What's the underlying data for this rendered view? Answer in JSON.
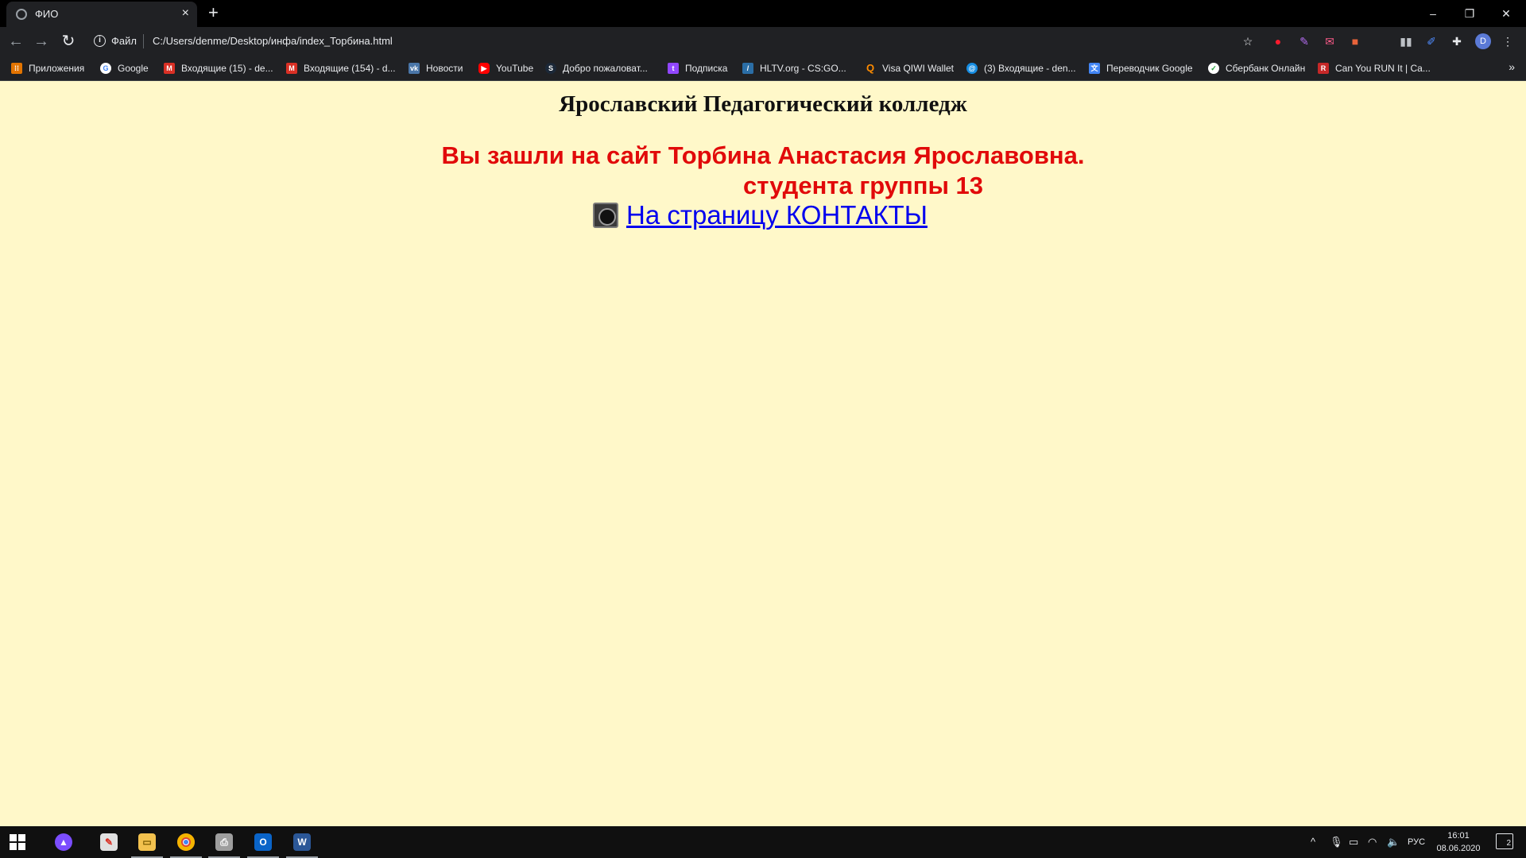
{
  "browser": {
    "tab": {
      "title": "ФИО",
      "close": "×"
    },
    "new_tab": "+",
    "window_controls": {
      "minimize": "–",
      "restore": "❐",
      "close": "✕"
    },
    "nav": {
      "back": "←",
      "forward": "→",
      "reload": "↻"
    },
    "omnibox": {
      "info": "i",
      "scheme": "Файл",
      "url": "C:/Users/denme/Desktop/инфа/index_Торбина.html"
    },
    "toolbar_icons": [
      "star-icon",
      "opera-icon",
      "feather-icon",
      "mail-ext-icon",
      "office-ext-icon",
      "audio-ext-icon",
      "pen-ext-icon",
      "puzzle-icon"
    ],
    "profile_initial": "D",
    "menu": "⋮"
  },
  "bookmarks": [
    {
      "label": "Приложения",
      "icon": "apps-grid-icon",
      "color": "#e37400"
    },
    {
      "label": "Google",
      "icon": "google-icon",
      "color": "#ffffff"
    },
    {
      "label": "Входящие (15) - de...",
      "icon": "gmail-icon",
      "color": "#d93025"
    },
    {
      "label": "Входящие (154) - d...",
      "icon": "gmail-icon",
      "color": "#d93025"
    },
    {
      "label": "Новости",
      "icon": "vk-icon",
      "color": "#4a76a8"
    },
    {
      "label": "YouTube",
      "icon": "youtube-icon",
      "color": "#ff0000"
    },
    {
      "label": "Добро пожаловат...",
      "icon": "steam-icon",
      "color": "#1b2838"
    },
    {
      "label": "Подписка",
      "icon": "twitch-icon",
      "color": "#9146ff"
    },
    {
      "label": "HLTV.org - CS:GO...",
      "icon": "hltv-icon",
      "color": "#2b6ea6"
    },
    {
      "label": "Visa QIWI Wallet",
      "icon": "qiwi-icon",
      "color": "#ff8c00"
    },
    {
      "label": "(3) Входящие - den...",
      "icon": "mailru-icon",
      "color": "#168de2"
    },
    {
      "label": "Переводчик Google",
      "icon": "translate-icon",
      "color": "#4285f4"
    },
    {
      "label": "Сбербанк Онлайн",
      "icon": "sberbank-icon",
      "color": "#21a038"
    },
    {
      "label": "Can You RUN It | Ca...",
      "icon": "canyourunit-icon",
      "color": "#c62828"
    }
  ],
  "bookmarks_more": "»",
  "page": {
    "college": "Ярославский Педагогический колледж",
    "greeting": "Вы зашли на сайт Торбина Анастасия Ярославовна.",
    "group": "студента группы 13",
    "contact_link": "На страницу КОНТАКТЫ",
    "background": "#fff8c9",
    "accent_red": "#e10a0a",
    "link_blue": "#0000ee"
  },
  "taskbar": {
    "apps": [
      "alice-icon",
      "paint-icon",
      "explorer-icon",
      "chrome-icon",
      "printer-icon",
      "outlook-icon",
      "word-icon"
    ],
    "tray": {
      "chevron": "^",
      "language": "РУС"
    },
    "clock": {
      "time": "16:01",
      "date": "08.06.2020"
    },
    "notifications": "2"
  }
}
